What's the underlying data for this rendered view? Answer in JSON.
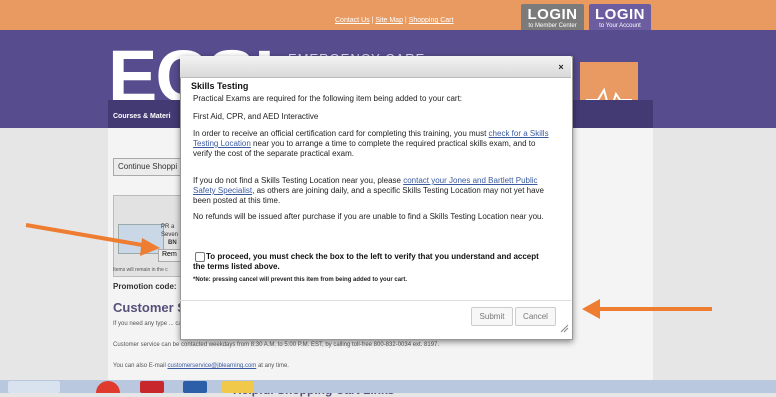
{
  "top": {
    "links": [
      "Contact Us",
      "Site Map",
      "Shopping Cart"
    ],
    "separator": " | ",
    "login_member": {
      "big": "LOGIN",
      "small": "to Member Center"
    },
    "login_account": {
      "big": "LOGIN",
      "small": "to Your Account"
    }
  },
  "header": {
    "logo": "ECSI",
    "tagline": "EMERGENCY CARE",
    "nav_left": "Courses & Materi",
    "nav_right": "r"
  },
  "page": {
    "continue_label": "Continue Shoppi",
    "cart_line1": "PR a",
    "cart_line2": "Seven",
    "cart_line3": "BN",
    "remove_label": "Rem",
    "items_note": "Items will remain in the c",
    "promo_label": "Promotion code:",
    "cs_heading": "Customer S",
    "cs_text1": "If you need any type ... can contact our customer service department.",
    "cs_text2": "Customer service can be contacted weekdays from 8:30 A.M. to 5:00 P.M. EST, by calling toll-free 800-832-0034 ext. 8197.",
    "cs_text3_prefix": "You can also E-mail ",
    "cs_text3_email": "customerservice@jblearning.com",
    "cs_text3_suffix": " at any time.",
    "helpful": "Helpful Shopping Cart Links"
  },
  "modal": {
    "close": "×",
    "title": "Skills Testing",
    "p1": "Practical Exams are required for the following item being added to your cart:",
    "p2": "First Aid, CPR, and AED Interactive",
    "p3_before": "In order to receive an official certification card for completing this training, you must ",
    "p3_link": "check for a Skills Testing Location",
    "p3_after": " near you to arrange a time to complete the required practical skills exam, and to verify the cost of the separate practical exam.",
    "p4_before": "If you do not find a Skills Testing Location near you, please ",
    "p4_link": "contact your Jones and Bartlett Public Safety Specialist",
    "p4_after": ", as others are joining daily, and a specific Skills Testing Location may not yet have been posted at this time.",
    "p5": "No refunds will be issued after purchase if you are unable to find a Skills Testing Location near you.",
    "proceed": "To proceed, you must check the box to the left to verify that you understand and accept the terms listed above.",
    "note": "*Note: pressing cancel will prevent this item from being added to your cart.",
    "submit": "Submit",
    "cancel": "Cancel",
    "checked": false
  },
  "colors": {
    "top_bar": "#e89a61",
    "header": "#574c8e",
    "arrow": "#ee7d32",
    "link": "#3b5aa0"
  }
}
